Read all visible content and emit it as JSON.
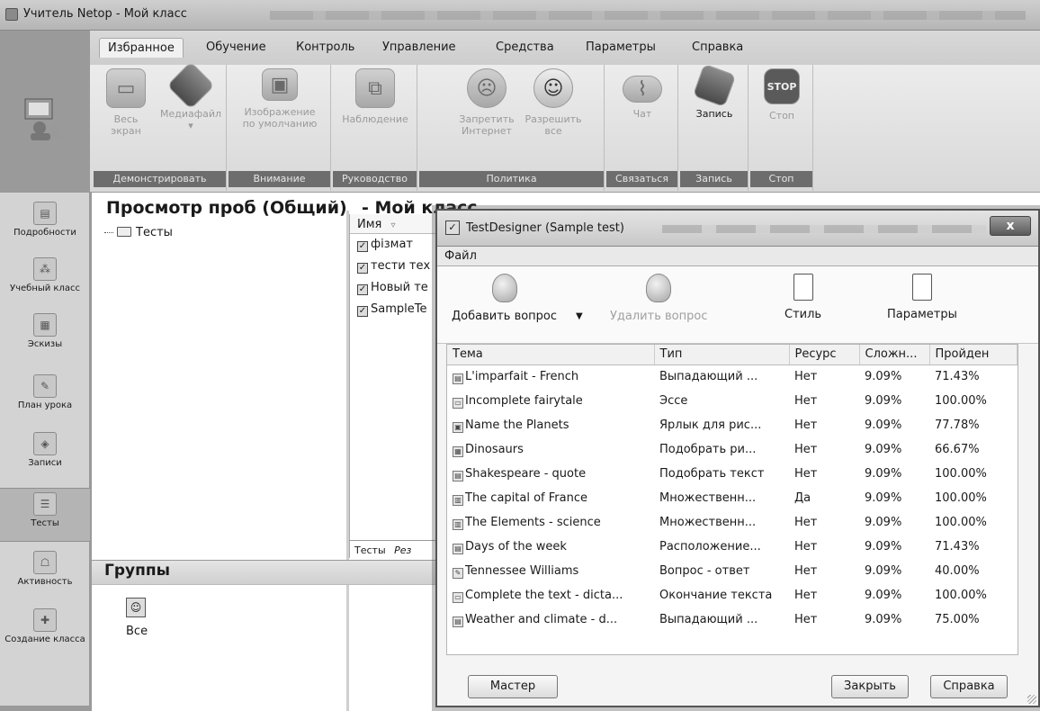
{
  "window": {
    "title": "Учитель Netop - Мой класс"
  },
  "ribbon": {
    "tabs": [
      "Избранное",
      "Обучение",
      "Контроль",
      "Управление",
      "Средства",
      "Параметры",
      "Справка"
    ],
    "groups": {
      "demo": {
        "label": "Демонстрировать",
        "btn1_line1": "Весь",
        "btn1_line2": "экран",
        "btn2": "Медиафайл"
      },
      "attention": {
        "label": "Внимание",
        "btn_line1": "Изображение",
        "btn_line2": "по умолчанию"
      },
      "guidance": {
        "label": "Руководство",
        "btn": "Наблюдение"
      },
      "policy": {
        "label": "Политика",
        "btn1_line1": "Запретить",
        "btn1_line2": "Интернет",
        "btn2_line1": "Разрешить",
        "btn2_line2": "все"
      },
      "connect": {
        "label": "Связаться",
        "btn": "Чат"
      },
      "record": {
        "label": "Запись",
        "btn": "Запись"
      },
      "stop": {
        "label": "Стоп",
        "btn": "Стоп",
        "icon_text": "STOP"
      }
    }
  },
  "sidebar": {
    "items": [
      "Подробности",
      "Учебный класс",
      "Эскизы",
      "План урока",
      "Записи",
      "Тесты",
      "Активность",
      "Создание класса"
    ]
  },
  "main": {
    "title": "Просмотр проб (Общий)",
    "subtitle": "- Мой класс",
    "tree_root": "Тесты",
    "files_header": "Имя",
    "files": [
      "фізмат",
      "тести тех",
      "Новый те",
      "SampleTe"
    ],
    "files_tabs": "Тесты",
    "files_tabs_2": "Рез",
    "groups_title": "Группы",
    "groups_all": "Все"
  },
  "dialog": {
    "title": "TestDesigner (Sample test)",
    "close": "x",
    "menu_file": "Файл",
    "toolbar": {
      "add_question": "Добавить вопрос",
      "delete_question": "Удалить вопрос",
      "style": "Стиль",
      "parameters": "Параметры"
    },
    "columns": [
      "Тема",
      "Тип",
      "Ресурс",
      "Сложн...",
      "Пройден"
    ],
    "rows": [
      [
        "L'imparfait - French",
        "Выпадающий ...",
        "Нет",
        "9.09%",
        "71.43%"
      ],
      [
        "Incomplete fairytale",
        "Эссе",
        "Нет",
        "9.09%",
        "100.00%"
      ],
      [
        "Name the Planets",
        "Ярлык для рис...",
        "Нет",
        "9.09%",
        "77.78%"
      ],
      [
        "Dinosaurs",
        "Подобрать ри...",
        "Нет",
        "9.09%",
        "66.67%"
      ],
      [
        "Shakespeare - quote",
        "Подобрать текст",
        "Нет",
        "9.09%",
        "100.00%"
      ],
      [
        "The capital of France",
        "Множественн...",
        "Да",
        "9.09%",
        "100.00%"
      ],
      [
        "The Elements - science",
        "Множественн...",
        "Нет",
        "9.09%",
        "100.00%"
      ],
      [
        "Days of the week",
        "Расположение...",
        "Нет",
        "9.09%",
        "71.43%"
      ],
      [
        "Tennessee Williams",
        "Вопрос - ответ",
        "Нет",
        "9.09%",
        "40.00%"
      ],
      [
        "Complete the text - dicta...",
        "Окончание текста",
        "Нет",
        "9.09%",
        "100.00%"
      ],
      [
        "Weather and climate - d...",
        "Выпадающий ...",
        "Нет",
        "9.09%",
        "75.00%"
      ]
    ],
    "buttons": {
      "wizard": "Мастер",
      "close": "Закрыть",
      "help": "Справка"
    }
  }
}
